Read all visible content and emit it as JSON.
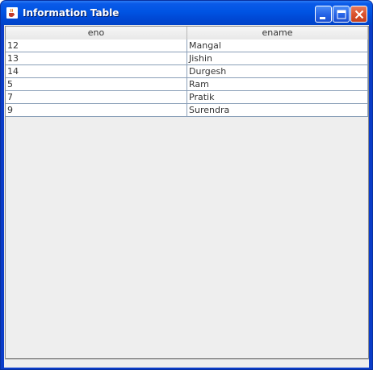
{
  "window": {
    "title": "Information Table"
  },
  "table": {
    "columns": [
      "eno",
      "ename"
    ],
    "rows": [
      [
        "12",
        "Mangal"
      ],
      [
        "13",
        "Jishin"
      ],
      [
        "14",
        "Durgesh"
      ],
      [
        "5",
        "Ram"
      ],
      [
        "7",
        "Pratik"
      ],
      [
        "9",
        "Surendra"
      ]
    ]
  },
  "icons": {
    "app": "java-cup-icon",
    "minimize": "minimize-icon",
    "maximize": "maximize-icon",
    "close": "close-icon"
  },
  "colors": {
    "titlebar": "#0054e3",
    "close_button": "#d9502c",
    "grid_line": "#8a9fb8"
  }
}
